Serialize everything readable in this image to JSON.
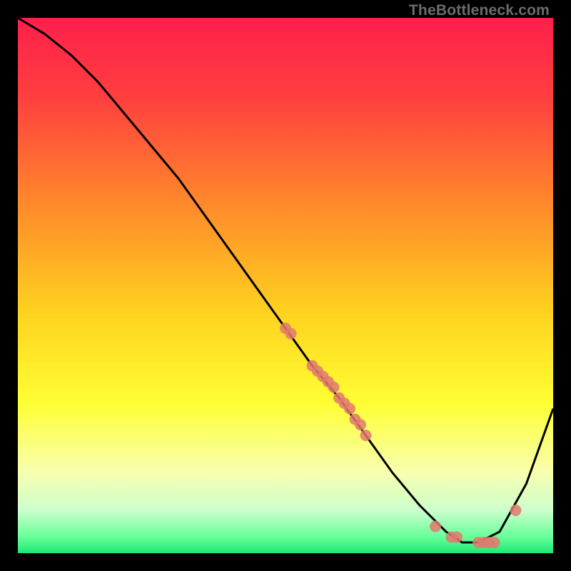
{
  "watermark": "TheBottleneck.com",
  "chart_data": {
    "type": "line",
    "title": "",
    "xlabel": "",
    "ylabel": "",
    "xlim": [
      0,
      100
    ],
    "ylim": [
      0,
      100
    ],
    "grid": false,
    "legend": false,
    "series": [
      {
        "name": "curve",
        "x": [
          0,
          5,
          10,
          15,
          20,
          25,
          30,
          35,
          40,
          45,
          50,
          55,
          60,
          65,
          70,
          75,
          80,
          83,
          86,
          90,
          95,
          100
        ],
        "y": [
          100,
          97,
          93,
          88,
          82,
          76,
          70,
          63,
          56,
          49,
          42,
          35,
          29,
          22,
          15,
          9,
          4,
          2,
          2,
          4,
          13,
          27
        ]
      }
    ],
    "scatter": {
      "name": "points",
      "color": "#e2796d",
      "x": [
        50,
        51,
        55,
        56,
        57,
        58,
        59,
        60,
        61,
        62,
        63,
        64,
        65,
        78,
        81,
        82,
        86,
        87,
        88,
        89,
        93
      ],
      "y": [
        42,
        41,
        35,
        34,
        33,
        32,
        31,
        29,
        28,
        27,
        25,
        24,
        22,
        5,
        3,
        3,
        2,
        2,
        2,
        2,
        8
      ]
    },
    "gradient_stops": [
      {
        "offset": 0.0,
        "color": "#ff1f4b"
      },
      {
        "offset": 0.15,
        "color": "#ff3f3f"
      },
      {
        "offset": 0.35,
        "color": "#ff8a2a"
      },
      {
        "offset": 0.55,
        "color": "#ffd21f"
      },
      {
        "offset": 0.72,
        "color": "#ffff33"
      },
      {
        "offset": 0.85,
        "color": "#f7ffb0"
      },
      {
        "offset": 0.92,
        "color": "#ccffcc"
      },
      {
        "offset": 0.97,
        "color": "#66ff99"
      },
      {
        "offset": 1.0,
        "color": "#1fe874"
      }
    ]
  }
}
